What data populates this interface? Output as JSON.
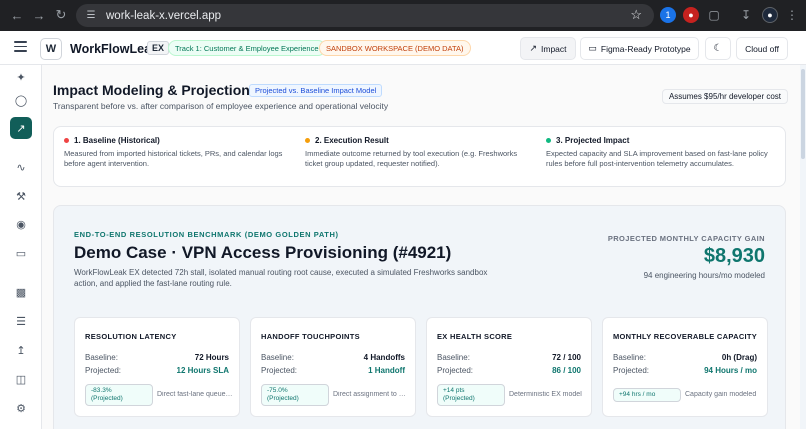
{
  "browser": {
    "url": "work-leak-x.vercel.app",
    "back_icon": "arrow-left-icon",
    "forward_icon": "arrow-right-icon",
    "reload_icon": "reload-icon",
    "bookmark_icon": "star-icon"
  },
  "header": {
    "logo_letter": "W",
    "brand": "WorkFlowLeak",
    "brand_badge": "EX",
    "track_pill": "Track 1: Customer & Employee Experience",
    "sandbox_pill": "SANDBOX WORKSPACE (DEMO DATA)",
    "impact_button": "Impact",
    "figma_button": "Figma-Ready Prototype",
    "cloud_button": "Cloud off"
  },
  "sidebar": {
    "items": [
      {
        "icon": "sparkle-icon"
      },
      {
        "icon": "shield-icon"
      },
      {
        "icon": "trend-icon",
        "active": true
      },
      {
        "icon": "activity-icon"
      },
      {
        "icon": "wrench-icon"
      },
      {
        "icon": "globe-icon"
      },
      {
        "icon": "monitor-icon"
      },
      {
        "icon": "bar-chart-icon"
      },
      {
        "icon": "checklist-icon"
      },
      {
        "icon": "upload-icon"
      },
      {
        "icon": "database-icon"
      },
      {
        "icon": "settings-icon"
      }
    ]
  },
  "page": {
    "title": "Impact Modeling & Projection",
    "model_badge": "Projected vs. Baseline Impact Model",
    "subtitle": "Transparent before vs. after comparison of employee experience and operational velocity",
    "assumption": "Assumes $95/hr developer cost"
  },
  "legend": [
    {
      "title": "1. Baseline (Historical)",
      "color": "#ef4444",
      "desc": "Measured from imported historical tickets, PRs, and calendar logs before agent intervention."
    },
    {
      "title": "2. Execution Result",
      "color": "#f59e0b",
      "desc": "Immediate outcome returned by tool execution (e.g. Freshworks ticket group updated, requester notified)."
    },
    {
      "title": "3. Projected Impact",
      "color": "#10b981",
      "desc": "Expected capacity and SLA improvement based on fast-lane policy rules before full post-intervention telemetry accumulates."
    }
  ],
  "benchmark": {
    "eyebrow": "END-TO-END RESOLUTION BENCHMARK (DEMO GOLDEN PATH)",
    "title": "Demo Case · VPN Access Provisioning (#4921)",
    "desc": "WorkFlowLeak EX detected 72h stall, isolated manual routing root cause, executed a simulated Freshworks sandbox action, and applied the fast-lane routing rule.",
    "gain_label": "PROJECTED MONTHLY CAPACITY GAIN",
    "gain_value": "$8,930",
    "gain_sub": "94 engineering hours/mo modeled"
  },
  "cards": [
    {
      "title": "RESOLUTION LATENCY",
      "baseline_label": "Baseline:",
      "baseline": "72 Hours",
      "projected_label": "Projected:",
      "projected": "12 Hours SLA",
      "chip_line1": "-83.3%",
      "chip_line2": "(Projected)",
      "note": "Direct fast-lane queue routing"
    },
    {
      "title": "HANDOFF TOUCHPOINTS",
      "baseline_label": "Baseline:",
      "baseline": "4 Handoffs",
      "projected_label": "Projected:",
      "projected": "1 Handoff",
      "chip_line1": "-75.0%",
      "chip_line2": "(Projected)",
      "note": "Direct assignment to owner"
    },
    {
      "title": "EX HEALTH SCORE",
      "baseline_label": "Baseline:",
      "baseline": "72 / 100",
      "projected_label": "Projected:",
      "projected": "86 / 100",
      "chip_line1": "+14 pts",
      "chip_line2": "(Projected)",
      "note": "Deterministic EX model"
    },
    {
      "title": "MONTHLY RECOVERABLE CAPACITY",
      "baseline_label": "Baseline:",
      "baseline": "0h (Drag)",
      "projected_label": "Projected:",
      "projected": "94 Hours / mo",
      "chip_line1": "+94 hrs / mo",
      "chip_line2": "",
      "note": "Capacity gain modeled"
    }
  ]
}
